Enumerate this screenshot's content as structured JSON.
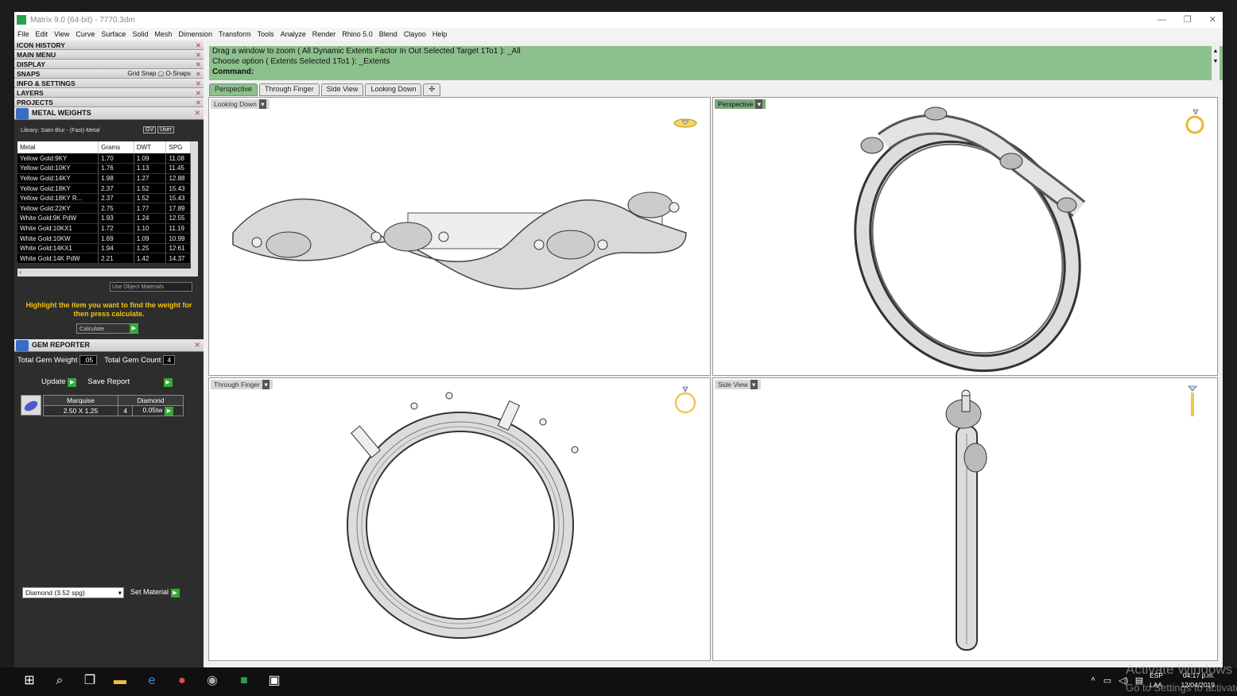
{
  "window": {
    "title": "Matrix 9.0 (64-bit) - 7770.3dm",
    "controls": [
      "—",
      "❐",
      "✕"
    ]
  },
  "menu": [
    "File",
    "Edit",
    "View",
    "Curve",
    "Surface",
    "Solid",
    "Mesh",
    "Dimension",
    "Transform",
    "Tools",
    "Analyze",
    "Render",
    "Rhino 5.0",
    "Blend",
    "Clayoo",
    "Help"
  ],
  "nav": [
    {
      "label": "ICON HISTORY"
    },
    {
      "label": "MAIN MENU"
    },
    {
      "label": "DISPLAY"
    },
    {
      "label": "SNAPS",
      "extra": "Grid Snap  ▢ O-Snaps"
    },
    {
      "label": "INFO & SETTINGS"
    },
    {
      "label": "LAYERS"
    },
    {
      "label": "PROJECTS"
    }
  ],
  "metal_weights": {
    "title": "METAL WEIGHTS",
    "library": "Library: Satin Blur - (Fast)-Metal",
    "lib_buttons": [
      "GV",
      "User"
    ],
    "columns": [
      "Metal",
      "Grams",
      "DWT",
      "SPG"
    ],
    "rows": [
      [
        "Yellow Gold:9KY",
        "1.70",
        "1.09",
        "11.08"
      ],
      [
        "Yellow Gold:10KY",
        "1.76",
        "1.13",
        "11.45"
      ],
      [
        "Yellow Gold:14KY",
        "1.98",
        "1.27",
        "12.88"
      ],
      [
        "Yellow Gold:18KY",
        "2.37",
        "1.52",
        "15.43"
      ],
      [
        "Yellow Gold:18KY R...",
        "2.37",
        "1.52",
        "15.43"
      ],
      [
        "Yellow Gold:22KY",
        "2.75",
        "1.77",
        "17.89"
      ],
      [
        "White Gold:9K PdW",
        "1.93",
        "1.24",
        "12.55"
      ],
      [
        "White Gold:10KX1",
        "1.72",
        "1.10",
        "11.19"
      ],
      [
        "White Gold:10KW",
        "1.69",
        "1.09",
        "10.99"
      ],
      [
        "White Gold:14KX1",
        "1.94",
        "1.25",
        "12.61"
      ],
      [
        "White Gold:14K PdW",
        "2.21",
        "1.42",
        "14.37"
      ]
    ],
    "use_object_materials": "Use Object Materials",
    "hint": "Highlight the item you want to find the weight for then press calculate.",
    "calculate": "Calculate"
  },
  "gem_reporter": {
    "title": "GEM REPORTER",
    "total_weight_label": "Total Gem Weight",
    "total_weight": ".05",
    "total_count_label": "Total Gem Count",
    "total_count": "4",
    "update": "Update",
    "save_report": "Save Report",
    "gem": {
      "shape": "Marquise",
      "size": "2.50 X 1.25",
      "material": "Diamond",
      "count": "4",
      "weight": "0.05tw"
    },
    "material_select": "Diamond    (3.52 spg)",
    "set_material": "Set Material"
  },
  "command": {
    "line1": "Drag a window to zoom ( All  Dynamic  Extents  Factor  In  Out  Selected  Target  1To1 ): _All",
    "line2": "Choose option ( Extents  Selected  1To1 ): _Extents",
    "prompt": "Command:"
  },
  "tabs": [
    "Perspective",
    "Through Finger",
    "Side View",
    "Looking Down",
    "✣"
  ],
  "viewports": {
    "top_left": "Looking Down",
    "top_right": "Perspective",
    "bottom_left": "Through Finger",
    "bottom_right": "Side View"
  },
  "taskbar": {
    "lang1": "ESP",
    "lang2": "LAA",
    "time": "04:17 p.m.",
    "date": "12/04/2019",
    "activate1": "Activate Windows",
    "activate2": "Go to Settings to activate"
  },
  "colors": {
    "accent_green": "#8cc08c",
    "hint_yellow": "#f4c20d",
    "panel_bg": "#2d2d2d"
  }
}
